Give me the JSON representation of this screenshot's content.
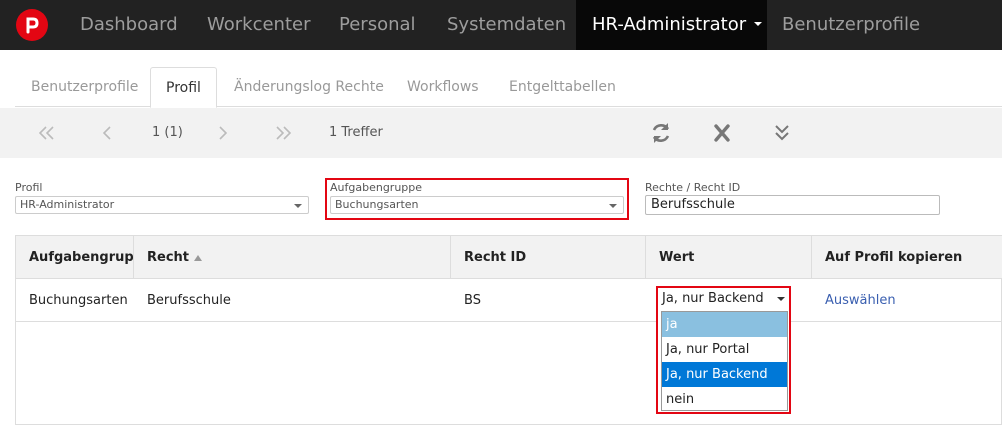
{
  "nav": {
    "items": [
      "Dashboard",
      "Workcenter",
      "Personal",
      "Systemdaten",
      "HR-Administrator",
      "Benutzerprofile"
    ],
    "active_index": 4,
    "colors": {
      "bar": "#222222",
      "active": "#080808",
      "logo": "#e30613"
    }
  },
  "tabs": [
    "Benutzerprofile",
    "Profil",
    "Änderungslog Rechte",
    "Workflows",
    "Entgelttabellen"
  ],
  "tabs_active_index": 1,
  "toolbar": {
    "page_info": "1 (1)",
    "result_count": "1 Treffer",
    "icons": [
      "double-chevron-left-icon",
      "chevron-left-icon",
      "chevron-right-icon",
      "double-chevron-right-icon",
      "refresh-icon",
      "close-icon",
      "double-chevron-down-icon"
    ]
  },
  "filters": {
    "profil_label": "Profil",
    "profil_value": "HR-Administrator",
    "aufgabengruppe_label": "Aufgabengruppe",
    "aufgabengruppe_value": "Buchungsarten",
    "recht_label": "Rechte / Recht ID",
    "recht_value": "Berufsschule"
  },
  "table": {
    "headers": [
      "Aufgabengruppe",
      "Recht",
      "Recht ID",
      "Wert",
      "Auf Profil kopieren"
    ],
    "rows": [
      {
        "aufgabengruppe": "Buchungsarten",
        "recht": "Berufsschule",
        "recht_id": "BS",
        "wert": "Ja, nur Backend",
        "kopieren": "Auswählen"
      }
    ]
  },
  "dropdown": {
    "current": "Ja, nur Backend",
    "options": [
      "ja",
      "Ja, nur Portal",
      "Ja, nur Backend",
      "nein"
    ],
    "hover_index": 0,
    "selected_index": 2
  },
  "highlight_color": "#e30613"
}
